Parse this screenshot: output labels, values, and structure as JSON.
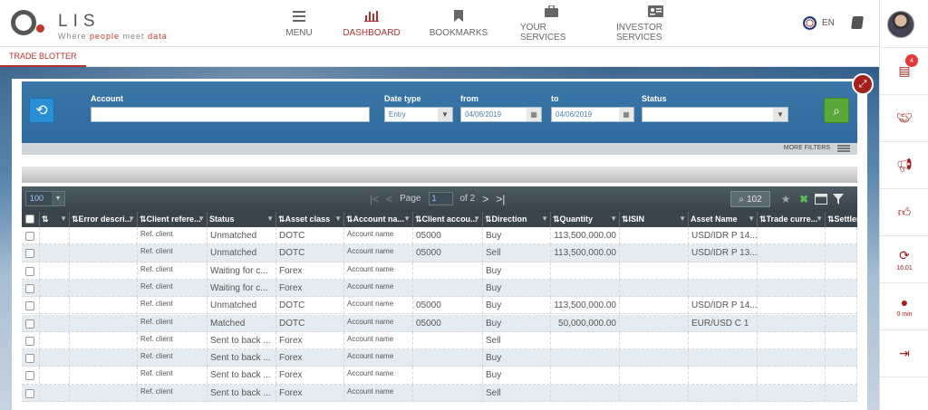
{
  "brand": {
    "name": "LIS",
    "tagline_pre": "Where ",
    "tagline_red1": "people",
    "tagline_mid": " meet ",
    "tagline_red2": "data"
  },
  "nav": [
    {
      "label": "MENU",
      "icon": "hamburger-icon",
      "active": false
    },
    {
      "label": "DASHBOARD",
      "icon": "bar-chart-icon",
      "active": true
    },
    {
      "label": "BOOKMARKS",
      "icon": "bookmark-icon",
      "active": false
    },
    {
      "label": "YOUR SERVICES",
      "icon": "briefcase-icon",
      "active": false
    },
    {
      "label": "INVESTOR SERVICES",
      "icon": "id-card-icon",
      "active": false
    }
  ],
  "lang": "EN",
  "tab": "TRADE BLOTTER",
  "filters": {
    "account_label": "Account",
    "account_value": "",
    "datetype_label": "Date type",
    "datetype_value": "Entry",
    "from_label": "from",
    "from_value": "04/06/2019",
    "to_label": "to",
    "to_value": "04/06/2019",
    "status_label": "Status",
    "status_value": "",
    "more_filters": "MORE FILTERS"
  },
  "grid": {
    "page_size": "100",
    "page_label": "Page",
    "page_value": "1",
    "of_label": "of 2",
    "count": "102"
  },
  "columns": [
    "Error descri...",
    "Client refere...",
    "Status",
    "Asset class",
    "Account na...",
    "Client accou...",
    "Direction",
    "Quantity",
    "ISIN",
    "Asset Name",
    "Trade curre...",
    "Settleme..."
  ],
  "rows": [
    {
      "ref": "Ref. client",
      "status": "Unmatched",
      "asset": "DOTC",
      "account": "Account name",
      "client": "05000",
      "dir": "Buy",
      "qty": "113,500,000.00",
      "name": "USD/IDR P 14..."
    },
    {
      "ref": "Ref. client",
      "status": "Unmatched",
      "asset": "DOTC",
      "account": "Account name",
      "client": "05000",
      "dir": "Sell",
      "qty": "113,500,000.00",
      "name": "USD/IDR P 13..."
    },
    {
      "ref": "Ref. client",
      "status": "Waiting for c...",
      "asset": "Forex",
      "account": "Account name",
      "client": "",
      "dir": "Buy",
      "qty": "",
      "name": ""
    },
    {
      "ref": "Ref. client",
      "status": "Waiting for c...",
      "asset": "Forex",
      "account": "Account name",
      "client": "",
      "dir": "Buy",
      "qty": "",
      "name": ""
    },
    {
      "ref": "Ref. client",
      "status": "Unmatched",
      "asset": "DOTC",
      "account": "Account name",
      "client": "05000",
      "dir": "Buy",
      "qty": "113,500,000.00",
      "name": "USD/IDR P 14..."
    },
    {
      "ref": "Ref. client",
      "status": "Matched",
      "asset": "DOTC",
      "account": "Account name",
      "client": "05000",
      "dir": "Buy",
      "qty": "50,000,000.00",
      "name": "EUR/USD C 1"
    },
    {
      "ref": "Ref. client",
      "status": "Sent to back ...",
      "asset": "Forex",
      "account": "Account name",
      "client": "",
      "dir": "Sell",
      "qty": "",
      "name": ""
    },
    {
      "ref": "Ref. client",
      "status": "Sent to back ...",
      "asset": "Forex",
      "account": "Account name",
      "client": "",
      "dir": "Buy",
      "qty": "",
      "name": ""
    },
    {
      "ref": "Ref. client",
      "status": "Sent to back ...",
      "asset": "Forex",
      "account": "Account name",
      "client": "",
      "dir": "Buy",
      "qty": "",
      "name": ""
    },
    {
      "ref": "Ref. client",
      "status": "Sent to back ...",
      "asset": "Forex",
      "account": "Account name",
      "client": "",
      "dir": "Sell",
      "qty": "",
      "name": ""
    }
  ],
  "rail": {
    "notifications": "4",
    "refresh_time": "16:01",
    "timer": "0 min"
  }
}
